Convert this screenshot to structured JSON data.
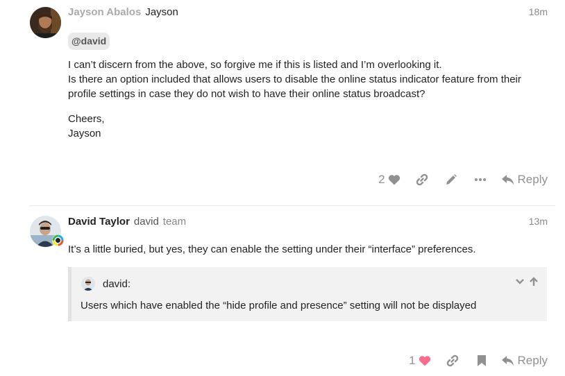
{
  "post1": {
    "username": "Jayson Abalos",
    "fullname": "Jayson",
    "date": "18m",
    "mention": "@david",
    "paragraph1": [
      "I can’t discern from the above, so forgive me if this is listed and I’m overlooking it.",
      "Is there an option included that allows users to disable the online status indicator feature from their",
      "profile settings in case they do not wish to have their online status broadcast?"
    ],
    "paragraph2": [
      "Cheers,",
      "Jayson"
    ],
    "like_count": "2",
    "reply_label": "Reply"
  },
  "post2": {
    "username": "David Taylor",
    "fullname": "david",
    "group": "team",
    "date": "13m",
    "body": "It’s a little buried, but yes, they can enable the setting under their “interface” preferences.",
    "quote": {
      "author": "david:",
      "text": "Users which have enabled the “hide profile and presence” setting will not be displayed"
    },
    "like_count": "1",
    "reply_label": "Reply"
  },
  "colors": {
    "muted": "#919191",
    "liked_heart": "#fa6c8d",
    "mention_bg": "#e9e9e9",
    "quote_bg": "#f2f2f2"
  }
}
